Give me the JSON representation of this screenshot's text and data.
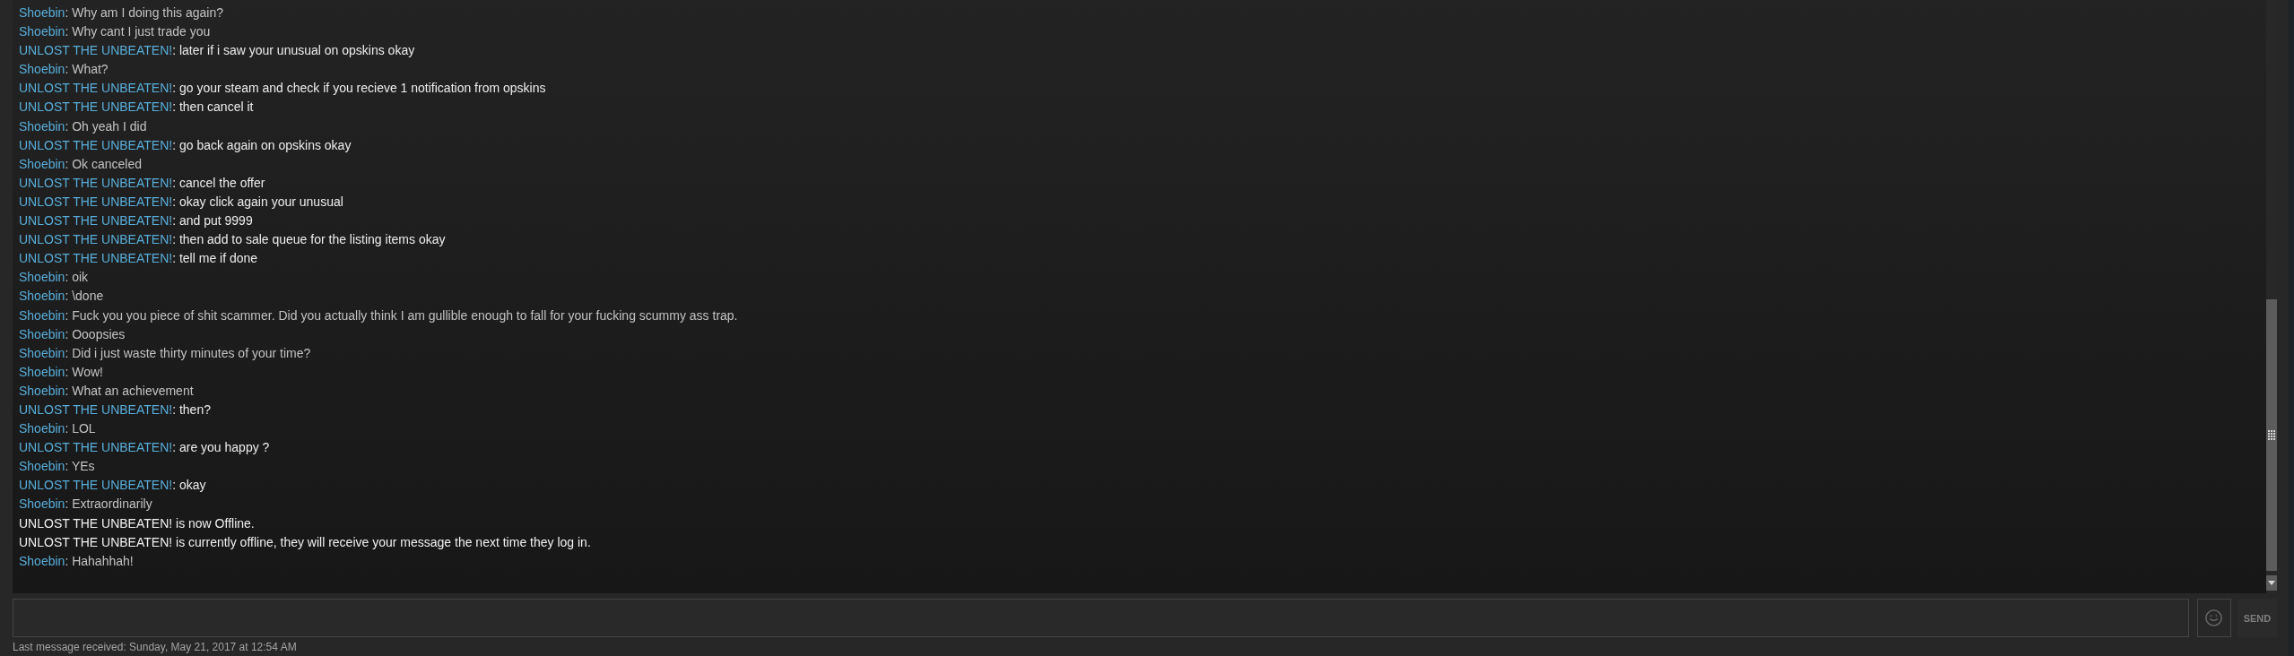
{
  "chat_log": {
    "messages": [
      {
        "kind": "self",
        "sender": "Shoebin",
        "text": ": Why am I doing this again?"
      },
      {
        "kind": "self",
        "sender": "Shoebin",
        "text": ": Why cant I just trade you"
      },
      {
        "kind": "friend",
        "sender": "UNLOST THE UNBEATEN!",
        "text": ": later if i saw your unusual on opskins okay"
      },
      {
        "kind": "self",
        "sender": "Shoebin",
        "text": ": What?"
      },
      {
        "kind": "friend",
        "sender": "UNLOST THE UNBEATEN!",
        "text": ": go your steam and check if you recieve 1 notification from opskins"
      },
      {
        "kind": "friend",
        "sender": "UNLOST THE UNBEATEN!",
        "text": ": then cancel it"
      },
      {
        "kind": "self",
        "sender": "Shoebin",
        "text": ": Oh yeah I did"
      },
      {
        "kind": "friend",
        "sender": "UNLOST THE UNBEATEN!",
        "text": ": go back again on opskins okay"
      },
      {
        "kind": "self",
        "sender": "Shoebin",
        "text": ": Ok canceled"
      },
      {
        "kind": "friend",
        "sender": "UNLOST THE UNBEATEN!",
        "text": ": cancel the offer"
      },
      {
        "kind": "friend",
        "sender": "UNLOST THE UNBEATEN!",
        "text": ": okay click again your unusual"
      },
      {
        "kind": "friend",
        "sender": "UNLOST THE UNBEATEN!",
        "text": ": and put 9999"
      },
      {
        "kind": "friend",
        "sender": "UNLOST THE UNBEATEN!",
        "text": ": then add to sale queue for the listing items okay"
      },
      {
        "kind": "friend",
        "sender": "UNLOST THE UNBEATEN!",
        "text": ": tell me if done"
      },
      {
        "kind": "self",
        "sender": "Shoebin",
        "text": ": oik"
      },
      {
        "kind": "self",
        "sender": "Shoebin",
        "text": ": \\done"
      },
      {
        "kind": "self",
        "sender": "Shoebin",
        "text": ": Fuck you you piece of shit scammer. Did you actually think I am gullible enough to fall for your fucking scummy ass trap."
      },
      {
        "kind": "self",
        "sender": "Shoebin",
        "text": ": Ooopsies"
      },
      {
        "kind": "self",
        "sender": "Shoebin",
        "text": ": Did i just waste thirty minutes of your time?"
      },
      {
        "kind": "self",
        "sender": "Shoebin",
        "text": ": Wow!"
      },
      {
        "kind": "self",
        "sender": "Shoebin",
        "text": ": What an achievement"
      },
      {
        "kind": "friend",
        "sender": "UNLOST THE UNBEATEN!",
        "text": ": then?"
      },
      {
        "kind": "self",
        "sender": "Shoebin",
        "text": ": LOL"
      },
      {
        "kind": "friend",
        "sender": "UNLOST THE UNBEATEN!",
        "text": ": are you happy ?"
      },
      {
        "kind": "self",
        "sender": "Shoebin",
        "text": ": YEs"
      },
      {
        "kind": "friend",
        "sender": "UNLOST THE UNBEATEN!",
        "text": ": okay"
      },
      {
        "kind": "self",
        "sender": "Shoebin",
        "text": ": Extraordinarily"
      },
      {
        "kind": "system",
        "text": "UNLOST THE UNBEATEN! is now Offline."
      },
      {
        "kind": "system",
        "text": "UNLOST THE UNBEATEN! is currently offline, they will receive your message the next time they log in."
      },
      {
        "kind": "self",
        "sender": "Shoebin",
        "text": ": Hahahhah!"
      }
    ]
  },
  "composer": {
    "send_label": "SEND"
  },
  "status_bar": {
    "text": "Last message received: Sunday, May 21, 2017 at 12:54 AM"
  }
}
